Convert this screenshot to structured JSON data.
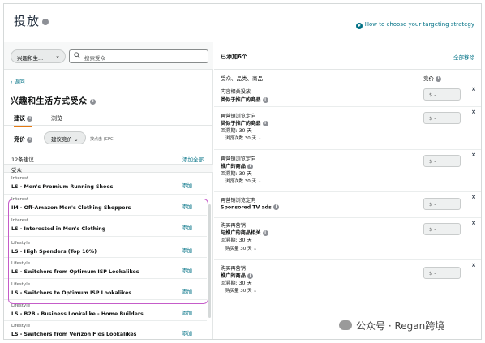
{
  "page_title": "投放",
  "help_link": "How to choose your targeting strategy",
  "left": {
    "type_dropdown": "兴趣和生...",
    "search_placeholder": "搜索受众",
    "back_label": "返回",
    "segment_title": "兴趣和生活方式受众",
    "tabs": [
      "建议",
      "浏览"
    ],
    "bid_label": "竞价",
    "bid_dropdown": "建议竞价",
    "bid_note": "按点击 (CPC)",
    "suggestions_count": "12条建议",
    "add_all": "添加全部",
    "column_header": "受众",
    "items": [
      {
        "category": "Interest",
        "name": "LS - Men's Premium Running Shoes",
        "action": "添加"
      },
      {
        "category": "Interest",
        "name": "IM - Off-Amazon Men's Clothing Shoppers",
        "action": "添加"
      },
      {
        "category": "Interest",
        "name": "LS - Interested in Men's Clothing",
        "action": "添加"
      },
      {
        "category": "Lifestyle",
        "name": "LS - High Spenders (Top 10%)",
        "action": "添加"
      },
      {
        "category": "Lifestyle",
        "name": "LS - Switchers from Optimum ISP Lookalikes",
        "action": "添加"
      },
      {
        "category": "Lifestyle",
        "name": "LS - Switchers to Optimum ISP Lookalikes",
        "action": "添加"
      },
      {
        "category": "Lifestyle",
        "name": "LS - B2B - Business Lookalike - Home Builders",
        "action": "添加"
      },
      {
        "category": "Lifestyle",
        "name": "LS - Switchers from Verizon Fios Lookalikes",
        "action": "添加"
      }
    ]
  },
  "right": {
    "added_count": "已添加6个",
    "remove_all": "全部移除",
    "col_audience": "受众、品类、商品",
    "col_bid": "竞价",
    "bid_placeholder": "$ -",
    "entries": [
      {
        "title": "内容相关投放",
        "bold": "类似于推广的商品",
        "lookback": "",
        "more": ""
      },
      {
        "title": "再营销浏览定向",
        "bold": "类似于推广的商品",
        "lookback": "回溯期: 30 天",
        "more": "浏览次数 30 天"
      },
      {
        "title": "再营销浏览定向",
        "bold": "推广的商品",
        "lookback": "回溯期: 30 天",
        "more": "浏览次数 30 天"
      },
      {
        "title": "再营销浏览定向",
        "bold": "Sponsored TV ads",
        "lookback": "",
        "more": ""
      },
      {
        "title": "购买再营销",
        "bold": "与推广的商品相关",
        "lookback": "回溯期: 30 天",
        "more": "购买量 30 天"
      },
      {
        "title": "购买再营销",
        "bold": "推广的商品",
        "lookback": "回溯期: 30 天",
        "more": "购买量 30 天"
      }
    ]
  },
  "watermark": "公众号 · Regan跨境"
}
